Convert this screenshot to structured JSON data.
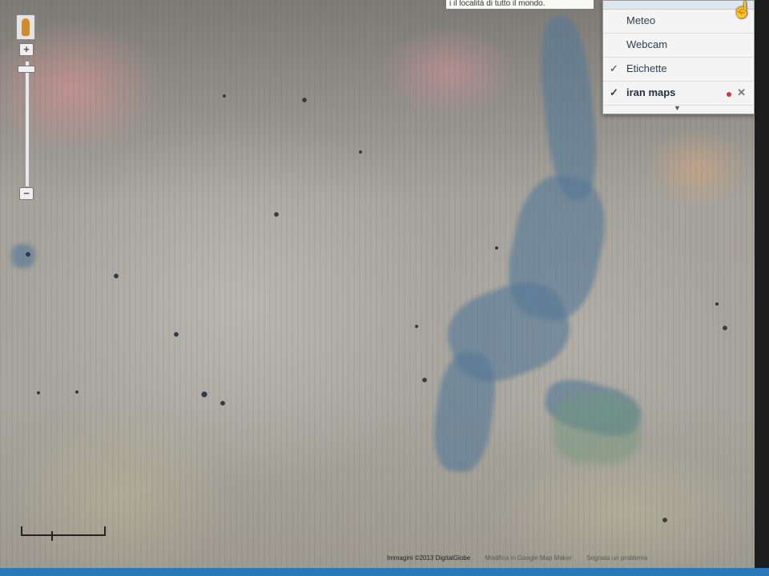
{
  "map": {
    "layer_type": "satellite"
  },
  "tooltip": {
    "text": "i il località di tutto il mondo."
  },
  "layers_menu": {
    "items": [
      {
        "label": "Meteo",
        "checked": false
      },
      {
        "label": "Webcam",
        "checked": false
      },
      {
        "label": "Etichette",
        "checked": true
      },
      {
        "label": "iran maps",
        "checked": true
      }
    ],
    "remove_icon": "close-icon",
    "expand_icon": "chevron-down-icon"
  },
  "zoom": {
    "plus_label": "+",
    "minus_label": "−",
    "pegman_icon": "pegman-icon"
  },
  "attribution": {
    "imagery": "Immagini ©2013 DigitalGlobe",
    "edit": "Modifica in Google Map Maker",
    "report": "Segnala un problema"
  },
  "colors": {
    "menu_bg": "#f4f4f4",
    "taskbar": "#2a78b8",
    "layer_dot": "#d23a3a"
  }
}
